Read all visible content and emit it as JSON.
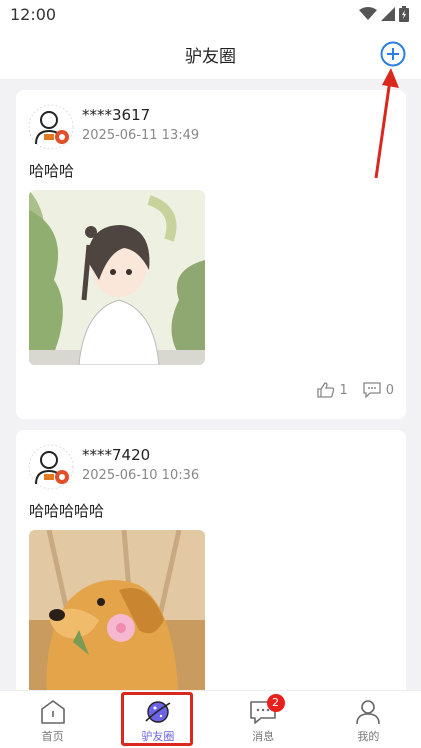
{
  "status": {
    "time": "12:00"
  },
  "header": {
    "title": "驴友圈"
  },
  "posts": [
    {
      "user": "****3617",
      "time": "2025-06-11 13:49",
      "text": "哈哈哈",
      "likes": "1",
      "comments": "0"
    },
    {
      "user": "****7420",
      "time": "2025-06-10 10:36",
      "text": "哈哈哈哈哈"
    }
  ],
  "tabs": [
    {
      "label": "首页"
    },
    {
      "label": "驴友圈"
    },
    {
      "label": "消息",
      "badge": "2"
    },
    {
      "label": "我的"
    }
  ],
  "colors": {
    "accent": "#6c63e8",
    "add_button": "#2a7fe2",
    "badge": "#e8201b",
    "annotation": "#d9281d"
  }
}
